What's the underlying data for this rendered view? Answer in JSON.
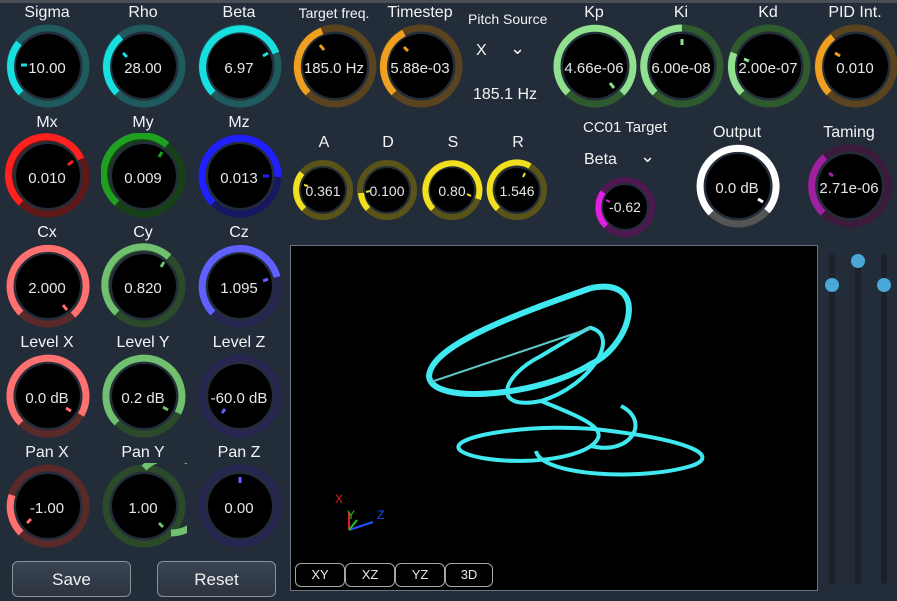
{
  "knobs": {
    "sigma": {
      "label": "Sigma",
      "value": "10.00",
      "color": "#19e0e0"
    },
    "rho": {
      "label": "Rho",
      "value": "28.00",
      "color": "#19e0e0"
    },
    "beta": {
      "label": "Beta",
      "value": "6.97",
      "color": "#19e0e0"
    },
    "target_freq": {
      "label": "Target freq.",
      "value": "185.0 Hz",
      "color": "#f0a020"
    },
    "timestep": {
      "label": "Timestep",
      "value": "5.88e-03",
      "color": "#f0a020"
    },
    "kp": {
      "label": "Kp",
      "value": "4.66e-06",
      "color": "#90e090"
    },
    "ki": {
      "label": "Ki",
      "value": "6.00e-08",
      "color": "#90e090"
    },
    "kd": {
      "label": "Kd",
      "value": "2.00e-07",
      "color": "#90e090"
    },
    "pid_int": {
      "label": "PID Int.",
      "value": "0.010",
      "color": "#f0a020"
    },
    "mx": {
      "label": "Mx",
      "value": "0.010",
      "color": "#ff2020"
    },
    "my": {
      "label": "My",
      "value": "0.009",
      "color": "#20a020"
    },
    "mz": {
      "label": "Mz",
      "value": "0.013",
      "color": "#2020ff"
    },
    "a": {
      "label": "A",
      "value": "0.361",
      "color": "#f0e020"
    },
    "d": {
      "label": "D",
      "value": "0.100",
      "color": "#f0e020"
    },
    "s": {
      "label": "S",
      "value": "0.80",
      "color": "#f0e020"
    },
    "r": {
      "label": "R",
      "value": "1.546",
      "color": "#f0e020"
    },
    "cc01": {
      "value": "-0.62",
      "color": "#e020e0"
    },
    "output": {
      "label": "Output",
      "value": "0.0 dB",
      "color": "#ffffff"
    },
    "taming": {
      "label": "Taming",
      "value": "2.71e-06",
      "color": "#a020a0"
    },
    "cx": {
      "label": "Cx",
      "value": "2.000",
      "color": "#ff7070"
    },
    "cy": {
      "label": "Cy",
      "value": "0.820",
      "color": "#70c070"
    },
    "cz": {
      "label": "Cz",
      "value": "1.095",
      "color": "#6060ff"
    },
    "level_x": {
      "label": "Level X",
      "value": "0.0 dB",
      "color": "#ff7070"
    },
    "level_y": {
      "label": "Level Y",
      "value": "0.2 dB",
      "color": "#70c070"
    },
    "level_z": {
      "label": "Level Z",
      "value": "-60.0 dB",
      "color": "#6060ff"
    },
    "pan_x": {
      "label": "Pan X",
      "value": "-1.00",
      "color": "#ff7070"
    },
    "pan_y": {
      "label": "Pan Y",
      "value": "1.00",
      "color": "#70c070"
    },
    "pan_z": {
      "label": "Pan Z",
      "value": "0.00",
      "color": "#6060ff"
    }
  },
  "pitch_source": {
    "label": "Pitch Source",
    "selected": "X",
    "readout": "185.1 Hz"
  },
  "cc01_target": {
    "label": "CC01 Target",
    "selected": "Beta"
  },
  "buttons": {
    "save": "Save",
    "reset": "Reset"
  },
  "view_buttons": [
    "XY",
    "XZ",
    "YZ",
    "3D"
  ],
  "axes": {
    "x": "X",
    "y": "Y",
    "z": "Z"
  },
  "plot_color": "#40e8f0"
}
